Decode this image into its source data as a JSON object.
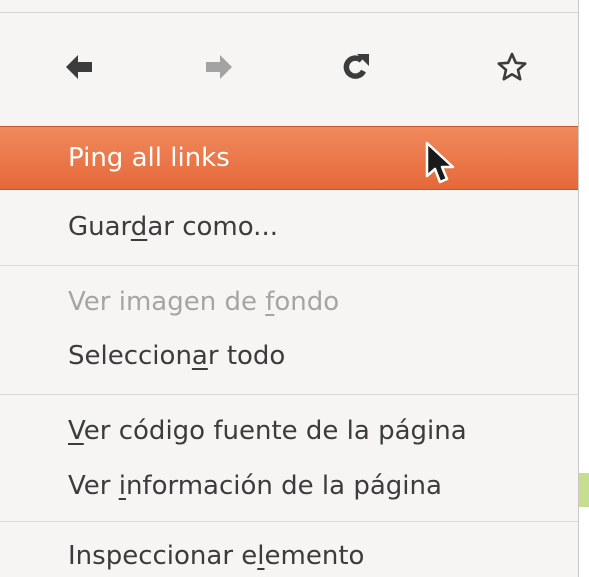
{
  "toolbar": {
    "back_icon": "arrow-left-icon",
    "forward_icon": "arrow-right-icon",
    "reload_icon": "reload-icon",
    "bookmark_icon": "star-icon"
  },
  "menu": {
    "ping_all_links": "Ping all links",
    "save_as": {
      "pre": "Guar",
      "key": "d",
      "post": "ar como..."
    },
    "view_background": {
      "pre": "Ver imagen de ",
      "key": "f",
      "post": "ondo"
    },
    "select_all": {
      "pre": "Seleccion",
      "key": "a",
      "post": "r todo"
    },
    "view_source": {
      "pre": "",
      "key": "V",
      "post": "er código fuente de la página"
    },
    "view_info": {
      "pre": "Ver ",
      "key": "i",
      "post": "nformación de la página"
    },
    "inspect": {
      "pre": "Inspeccionar e",
      "key": "l",
      "post": "emento"
    }
  },
  "colors": {
    "highlight": "#e96f41",
    "menu_bg": "#f6f5f3",
    "text": "#3c3c3c",
    "disabled_text": "#a6a5a2",
    "icon_active": "#3c3c3c",
    "icon_disabled": "#a3a3a3"
  }
}
